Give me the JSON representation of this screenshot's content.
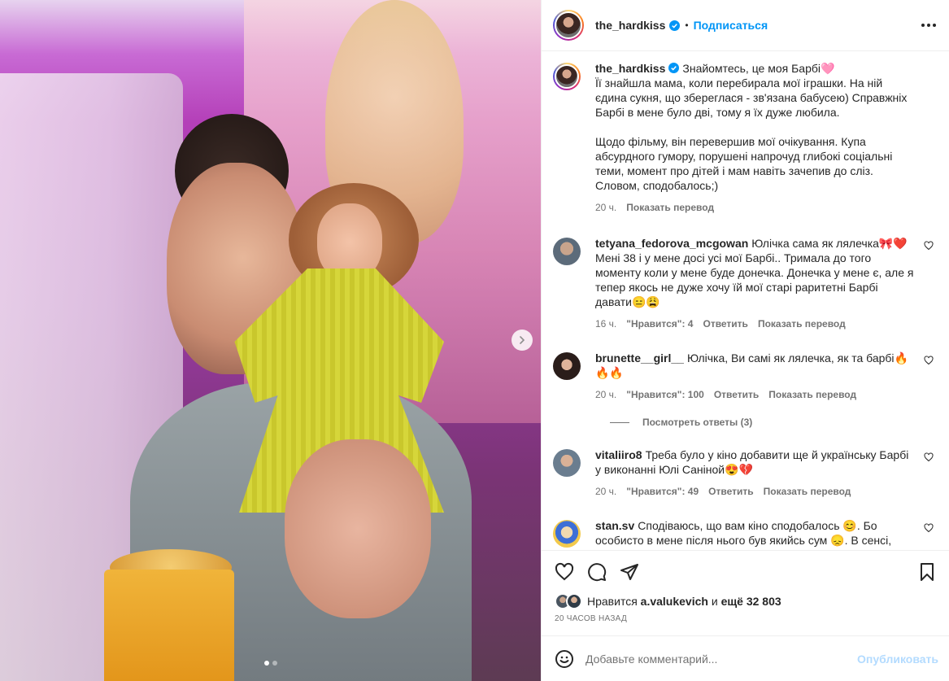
{
  "post": {
    "author": "the_hardkiss",
    "follow_label": "Подписаться",
    "dot": "•"
  },
  "caption": {
    "user": "the_hardkiss",
    "text": "Знайомтесь, це моя Барбі🩷\nЇї знайшла мама, коли перебирала мої іграшки. На ній єдина сукня, що збереглася - зв'язана бабусею) Справжніх Барбі в мене було дві, тому я їх дуже любила.\n\nЩодо фільму, він перевершив мої очікування. Купа абсурдного гумору, порушені напрочуд глибокі соціальні теми, момент про дітей і мам навіть зачепив до сліз. Словом, сподобалось;)",
    "time": "20 ч.",
    "translate": "Показать перевод"
  },
  "comments": [
    {
      "user": "tetyana_fedorova_mcgowan",
      "text": "Юлічка сама як лялечка🎀❤️ Мені 38 і у мене досі усі мої Барбі.. Тримала до того моменту коли у мене буде донечка. Донечка у мене є, але я тепер якось не дуже хочу їй мої старі раритетні Барбі давати😑😩",
      "time": "16 ч.",
      "likes": "\"Нравится\": 4",
      "reply": "Ответить",
      "translate": "Показать перевод",
      "avatar_color": "#5c6b7a"
    },
    {
      "user": "brunette__girl__",
      "text": "Юлічка, Ви самі як лялечка, як та барбі🔥🔥🔥",
      "time": "20 ч.",
      "likes": "\"Нравится\": 100",
      "reply": "Ответить",
      "translate": "Показать перевод",
      "avatar_color": "#3b2a26"
    },
    {
      "user": "vitaliiro8",
      "text": "Треба було у кіно добавити ще й українську Барбі у виконанні Юлі Саніной😍💔",
      "time": "20 ч.",
      "likes": "\"Нравится\": 49",
      "reply": "Ответить",
      "translate": "Показать перевод",
      "avatar_color": "#6a7d8f"
    },
    {
      "user": "stan.sv",
      "text": "Сподіваюсь, що вам кіно сподобалось 😊. Бо особисто в мене після нього був якийсь сум 😞. В сенсі, гумор зачіпний і актерська гра, але якість в роботі наче не та...",
      "time": "",
      "likes": "",
      "reply": "",
      "translate": "",
      "avatar_color": "#f2c94c"
    }
  ],
  "view_replies": "Посмотреть ответы (3)",
  "likes_row": {
    "prefix": "Нравится",
    "user": "a.valukevich",
    "middle": "и",
    "count": "ещё 32 803"
  },
  "time_ago": "20 ЧАСОВ НАЗАД",
  "comment_input": {
    "placeholder": "Добавьте комментарий...",
    "publish": "Опубликовать"
  },
  "icons": {
    "verified": "verified-badge-icon",
    "like": "heart-icon",
    "comment": "comment-icon",
    "share": "paper-plane-icon",
    "save": "bookmark-icon",
    "emoji": "emoji-smile-icon",
    "more": "more-horizontal-icon",
    "next": "chevron-right-icon"
  },
  "colors": {
    "accent": "#0095f6",
    "publish_disabled": "#b3dbff",
    "muted": "#737373"
  }
}
